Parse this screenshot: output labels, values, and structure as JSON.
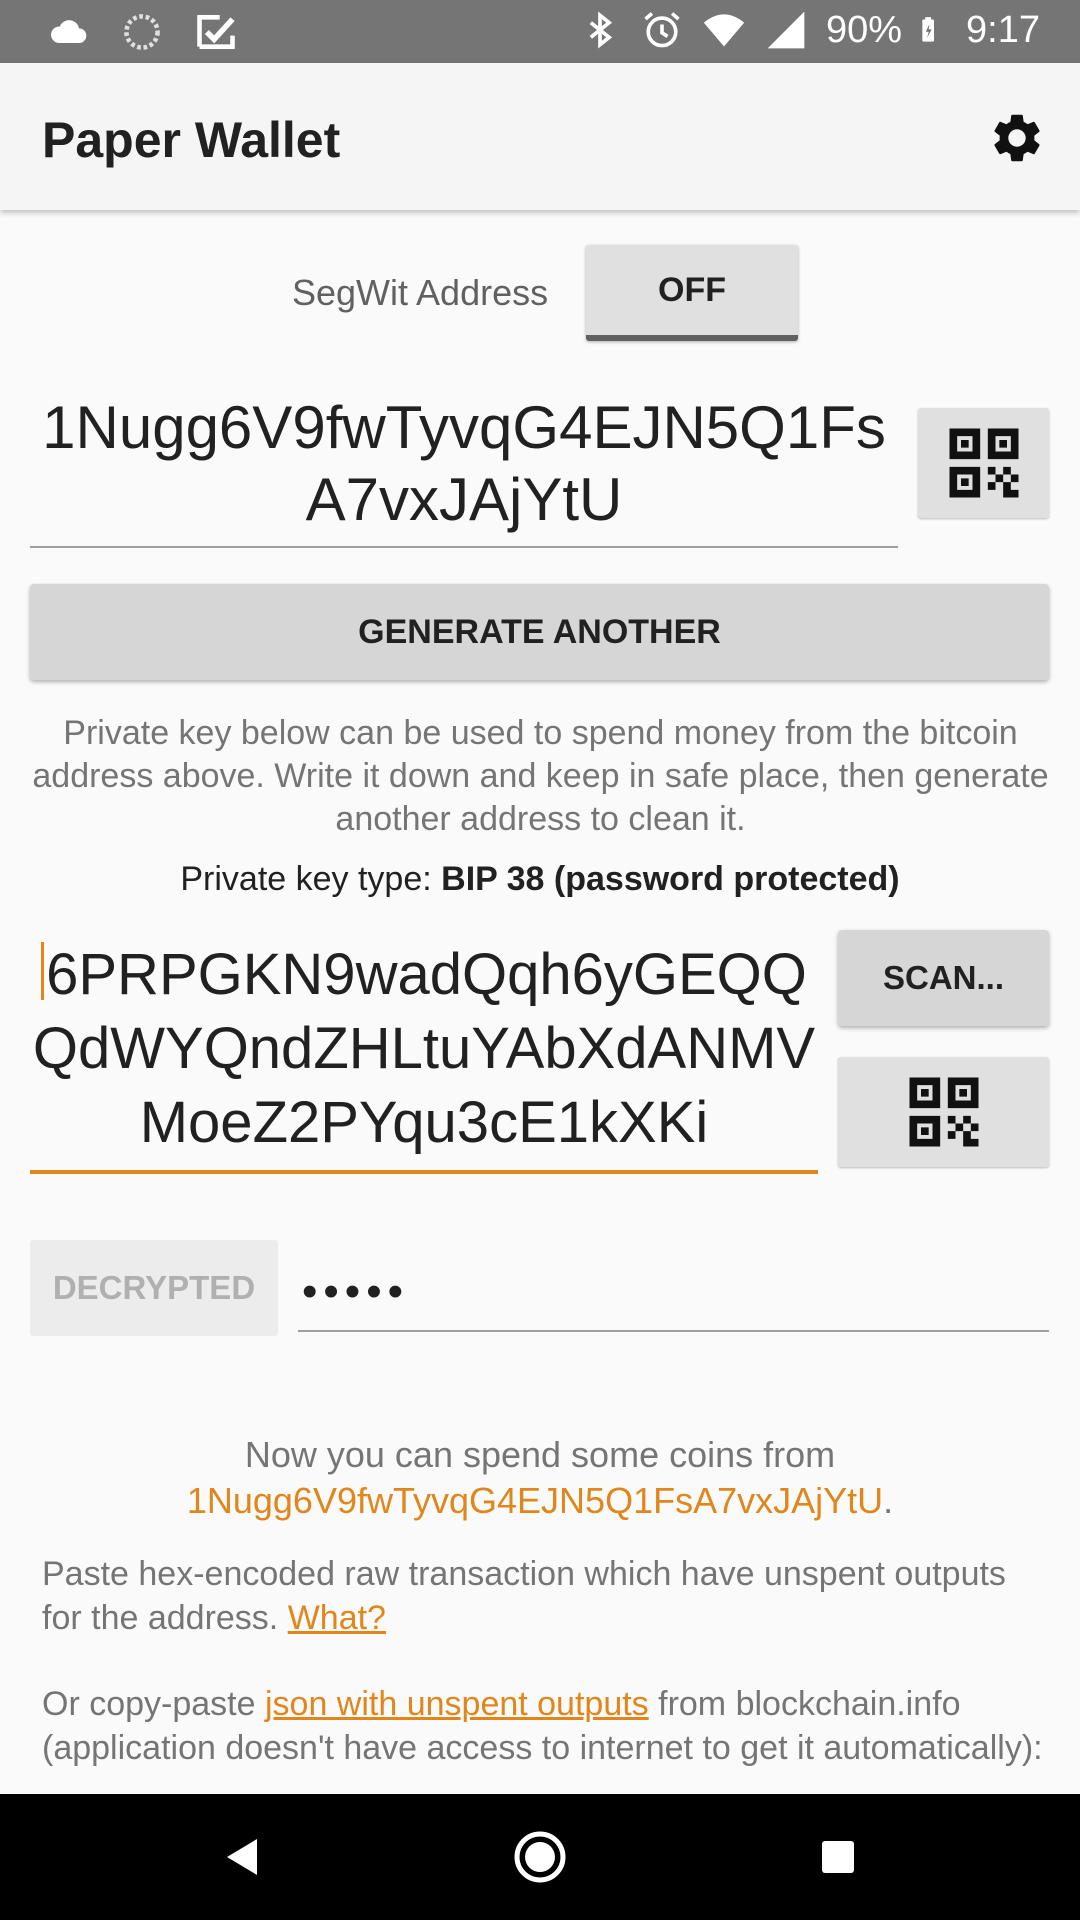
{
  "status_bar": {
    "battery": "90%",
    "time": "9:17",
    "icons": [
      "cloud-icon",
      "sync-icon",
      "inbox-check-icon",
      "bluetooth-icon",
      "alarm-icon",
      "wifi-icon",
      "signal-icon",
      "battery-icon"
    ]
  },
  "app_bar": {
    "title": "Paper Wallet",
    "settings_icon": "gear-icon"
  },
  "segwit": {
    "label": "SegWit Address",
    "toggle": "OFF"
  },
  "address": {
    "value": "1Nugg6V9fwTyvqG4EJN5Q1FsA7vxJAjYtU",
    "qr_icon": "qr-code-icon"
  },
  "generate_button": "GENERATE ANOTHER",
  "warning": "Private key below can be used to spend money from the bitcoin address above. Write it down and keep in safe place, then generate another address to clean it.",
  "key_type": {
    "label": "Private key type: ",
    "value": "BIP 38 (password protected)"
  },
  "private_key": {
    "value": "6PRPGKN9wadQqh6yGEQQQdWYQndZHLtuYAbXdANMVMoeZ2PYqu3cE1kXKi",
    "scan_button": "SCAN...",
    "qr_icon": "qr-code-icon"
  },
  "decrypt": {
    "button": "DECRYPTED",
    "password_mask": "•••••"
  },
  "spend": {
    "prefix": "Now you can spend some coins from",
    "address": "1Nugg6V9fwTyvqG4EJN5Q1FsA7vxJAjYtU",
    "suffix": "."
  },
  "paste": {
    "text": "Paste hex-encoded raw transaction which have unspent outputs for the address. ",
    "link": "What?"
  },
  "copy": {
    "prefix": "Or copy-paste ",
    "link": "json with unspent outputs",
    "suffix": " from blockchain.info (application doesn't have access to internet to get it automatically):"
  },
  "nav": {
    "back": "back-icon",
    "home": "home-icon",
    "recents": "recents-icon"
  }
}
